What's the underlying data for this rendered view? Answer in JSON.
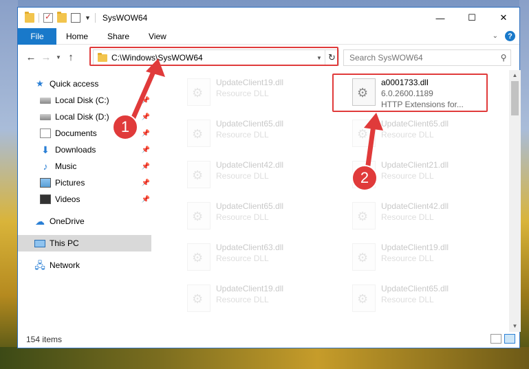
{
  "window": {
    "title": "SysWOW64",
    "controls": {
      "minimize": "—",
      "maximize": "☐",
      "close": "✕"
    }
  },
  "ribbon": {
    "tabs": [
      "File",
      "Home",
      "Share",
      "View"
    ],
    "help": "?"
  },
  "navigation": {
    "address": "C:\\Windows\\SysWOW64",
    "search_placeholder": "Search SysWOW64"
  },
  "sidebar": {
    "quick_access": "Quick access",
    "quick_items": [
      {
        "label": "Local Disk (C:)",
        "icon": "disk-icon"
      },
      {
        "label": "Local Disk (D:)",
        "icon": "disk-icon"
      },
      {
        "label": "Documents",
        "icon": "documents-icon"
      },
      {
        "label": "Downloads",
        "icon": "downloads-icon"
      },
      {
        "label": "Music",
        "icon": "music-icon"
      },
      {
        "label": "Pictures",
        "icon": "pictures-icon"
      },
      {
        "label": "Videos",
        "icon": "videos-icon"
      }
    ],
    "onedrive": "OneDrive",
    "this_pc": "This PC",
    "network": "Network"
  },
  "files": [
    {
      "name": "UpdateClient19.dll",
      "type": "Resource DLL"
    },
    {
      "name": "a0001733.dll",
      "version": "6.0.2600.1189",
      "desc": "HTTP Extensions for..."
    },
    {
      "name": "UpdateClient65.dll",
      "type": "Resource DLL"
    },
    {
      "name": "UpdateClient65.dll",
      "type": "Resource DLL"
    },
    {
      "name": "UpdateClient42.dll",
      "type": "Resource DLL"
    },
    {
      "name": "UpdateClient21.dll",
      "type": "Resource DLL"
    },
    {
      "name": "UpdateClient65.dll",
      "type": "Resource DLL"
    },
    {
      "name": "UpdateClient42.dll",
      "type": "Resource DLL"
    },
    {
      "name": "UpdateClient63.dll",
      "type": "Resource DLL"
    },
    {
      "name": "UpdateClient19.dll",
      "type": "Resource DLL"
    },
    {
      "name": "UpdateClient19.dll",
      "type": "Resource DLL"
    },
    {
      "name": "UpdateClient65.dll",
      "type": "Resource DLL"
    }
  ],
  "status": {
    "item_count": "154 items"
  },
  "annotations": {
    "step1": "1",
    "step2": "2"
  },
  "colors": {
    "accent": "#1979ca",
    "highlight": "#e03a3a"
  }
}
